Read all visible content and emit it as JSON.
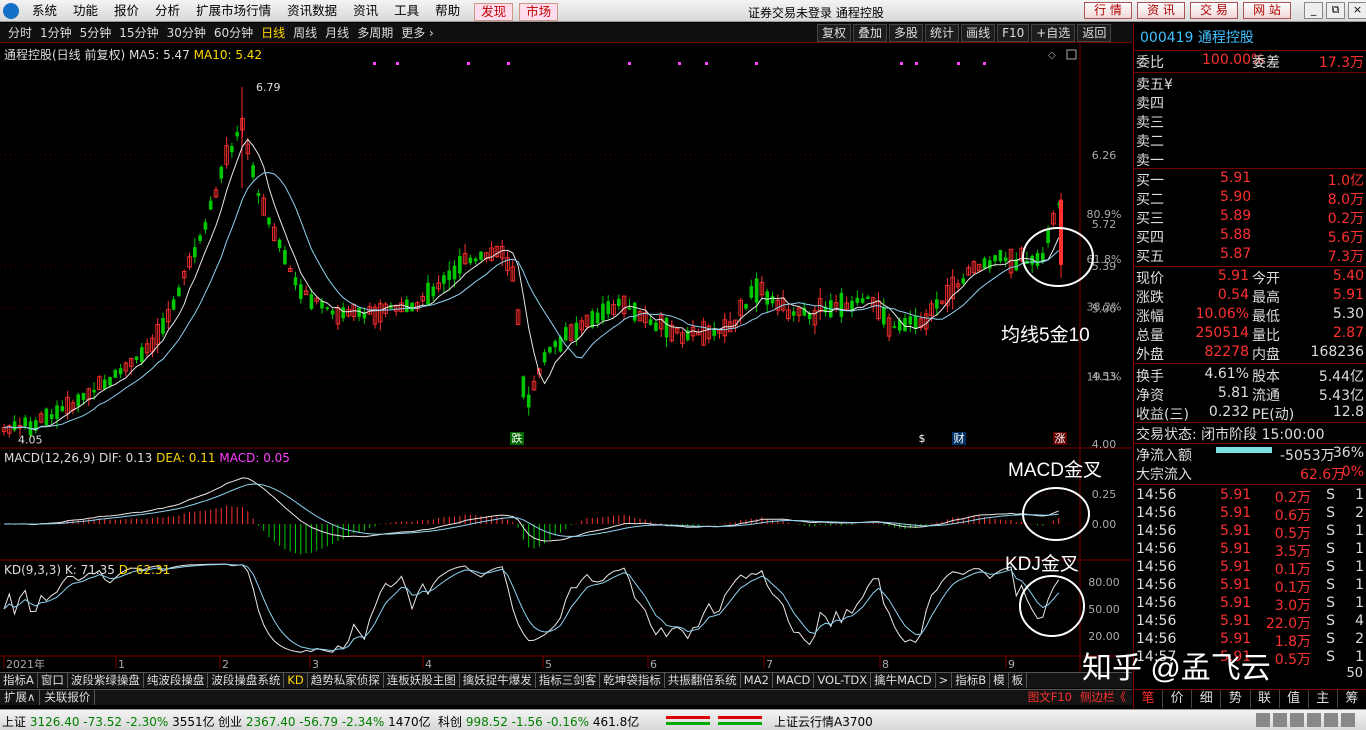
{
  "menubar": {
    "items": [
      "系统",
      "功能",
      "报价",
      "分析",
      "扩展市场行情",
      "资讯数据",
      "资讯",
      "工具",
      "帮助"
    ],
    "red_items": [
      "发现",
      "市场"
    ],
    "title": "证券交易未登录  通程控股",
    "buttons": [
      "行 情",
      "资 讯",
      "交 易",
      "网 站"
    ],
    "window_controls": [
      "_",
      "⧉",
      "×"
    ]
  },
  "toolbar": {
    "periods": [
      "分时",
      "1分钟",
      "5分钟",
      "15分钟",
      "30分钟",
      "60分钟",
      "日线",
      "周线",
      "月线",
      "多周期",
      "更多 ›"
    ],
    "active": "日线",
    "tools": [
      "复权",
      "叠加",
      "多股",
      "统计",
      "画线",
      "F10",
      "+自选",
      "返回"
    ]
  },
  "chart": {
    "title": "通程控股(日线 前复权)",
    "ma5_label": "MA5: 5.47",
    "ma10_label": "MA10: 5.42",
    "high_marker": "6.79",
    "low_marker": "4.05",
    "markers": {
      "die": "跌",
      "s": "$",
      "cai": "财",
      "zhang": "涨"
    },
    "price_axis": [
      "6.26",
      "5.72",
      "5.39",
      "5.06",
      "4.53",
      "4.00"
    ],
    "pct_axis": [
      "80.9%",
      "61.8%",
      "38.2%",
      "19.1%"
    ],
    "macd_title": "MACD(12,26,9)",
    "macd_dif": "DIF: 0.13",
    "macd_dea": "DEA: 0.11",
    "macd_val": "MACD: 0.05",
    "macd_axis": [
      "0.25",
      "0.00"
    ],
    "kd_title": "KD(9,3,3)",
    "kd_k": "K: 71.35",
    "kd_d": "D: 62.31",
    "kd_axis": [
      "80.00",
      "50.00",
      "20.00"
    ],
    "time_axis": [
      "2021年",
      "1",
      "2",
      "3",
      "4",
      "5",
      "6",
      "7",
      "8",
      "9"
    ]
  },
  "annotations": {
    "ma_cross": "均线5金10",
    "macd_cross": "MACD金叉",
    "kdj_cross": "KDJ金叉"
  },
  "indicator_tabs": [
    "指标A",
    "窗口",
    "波段紫绿操盘",
    "纯波段操盘",
    "波段操盘系统",
    "KD",
    "趋势私家侦探",
    "连板妖股主图",
    "擒妖捉牛爆发",
    "指标三剑客",
    "乾坤袋指标",
    "共振翻倍系统",
    "MA2",
    "MACD",
    "VOL-TDX",
    "擒牛MACD",
    ">",
    "指标B",
    "模",
    "板"
  ],
  "tabs2": {
    "left": [
      "扩展∧",
      "关联报价"
    ],
    "right": [
      "图文F10",
      "侧边栏《"
    ]
  },
  "status": {
    "sh": {
      "name": "上证",
      "value": "3126.40",
      "chg": "-73.52",
      "pct": "-2.30%",
      "amt": "3551亿"
    },
    "cy": {
      "name": "创业",
      "value": "2367.40",
      "chg": "-56.79",
      "pct": "-2.34%",
      "amt": "1470亿"
    },
    "kc": {
      "name": "科创",
      "value": "998.52",
      "chg": "-1.56",
      "pct": "-0.16%",
      "amt": "461.8亿"
    },
    "cloud": "上证云行情A3700"
  },
  "quote": {
    "code": "000419 通程控股",
    "weibi_label": "委比",
    "weibi": "100.00%",
    "weicha_label": "委差",
    "weicha": "17.3万",
    "sells": [
      "卖五",
      "卖四",
      "卖三",
      "卖二",
      "卖一"
    ],
    "buys": [
      {
        "l": "买一",
        "p": "5.91",
        "v": "1.0亿"
      },
      {
        "l": "买二",
        "p": "5.90",
        "v": "8.0万"
      },
      {
        "l": "买三",
        "p": "5.89",
        "v": "0.2万"
      },
      {
        "l": "买四",
        "p": "5.88",
        "v": "5.6万"
      },
      {
        "l": "买五",
        "p": "5.87",
        "v": "7.3万"
      }
    ],
    "stats": [
      {
        "l1": "现价",
        "v1": "5.91",
        "l2": "今开",
        "v2": "5.40"
      },
      {
        "l1": "涨跌",
        "v1": "0.54",
        "l2": "最高",
        "v2": "5.91"
      },
      {
        "l1": "涨幅",
        "v1": "10.06%",
        "l2": "最低",
        "v2": "5.30"
      },
      {
        "l1": "总量",
        "v1": "250514",
        "l2": "量比",
        "v2": "2.87"
      },
      {
        "l1": "外盘",
        "v1": "82278",
        "l2": "内盘",
        "v2": "168236"
      }
    ],
    "fin": [
      {
        "l1": "换手",
        "v1": "4.61%",
        "l2": "股本",
        "v2": "5.44亿"
      },
      {
        "l1": "净资",
        "v1": "5.81",
        "l2": "流通",
        "v2": "5.43亿"
      },
      {
        "l1": "收益(三)",
        "v1": "0.232",
        "l2": "PE(动)",
        "v2": "12.8"
      }
    ],
    "trade_status": "交易状态: 闭市阶段 15:00:00",
    "netflow_label": "净流入额",
    "netflow": "-5053万",
    "netflow_pct": "-36%",
    "block_label": "大宗流入",
    "block": "62.6万",
    "block_pct": "0%",
    "ticks": [
      {
        "t": "14:56",
        "p": "5.91",
        "v": "0.2万",
        "s": "S",
        "n": "1"
      },
      {
        "t": "14:56",
        "p": "5.91",
        "v": "0.6万",
        "s": "S",
        "n": "2"
      },
      {
        "t": "14:56",
        "p": "5.91",
        "v": "0.5万",
        "s": "S",
        "n": "1"
      },
      {
        "t": "14:56",
        "p": "5.91",
        "v": "3.5万",
        "s": "S",
        "n": "1"
      },
      {
        "t": "14:56",
        "p": "5.91",
        "v": "0.1万",
        "s": "S",
        "n": "1"
      },
      {
        "t": "14:56",
        "p": "5.91",
        "v": "0.1万",
        "s": "S",
        "n": "1"
      },
      {
        "t": "14:56",
        "p": "5.91",
        "v": "3.0万",
        "s": "S",
        "n": "1"
      },
      {
        "t": "14:56",
        "p": "5.91",
        "v": "22.0万",
        "s": "S",
        "n": "4"
      },
      {
        "t": "14:56",
        "p": "5.91",
        "v": "1.8万",
        "s": "S",
        "n": "2"
      },
      {
        "t": "14:57",
        "p": "5.91",
        "v": "0.5万",
        "s": "S",
        "n": "1"
      }
    ],
    "bottom_tabs": [
      "笔",
      "价",
      "细",
      "势",
      "联",
      "值",
      "主",
      "筹"
    ],
    "tail_number": "50"
  },
  "watermark": "知乎 @孟飞云"
}
